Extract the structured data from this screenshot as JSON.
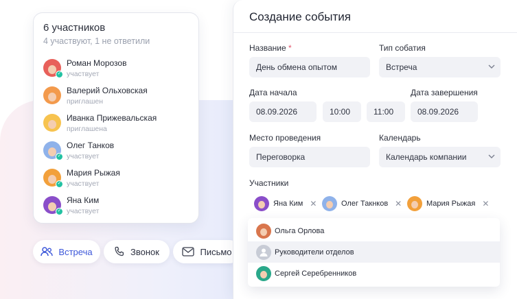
{
  "participants_card": {
    "title": "6 участников",
    "subtitle": "4 участвуют, 1 не ответили",
    "people": [
      {
        "name": "Роман Морозов",
        "status": "участвует",
        "avatar_color": "#e8605a",
        "accepted": true
      },
      {
        "name": "Валерий Ольховская",
        "status": "приглашен",
        "avatar_color": "#f39a4c",
        "accepted": false
      },
      {
        "name": "Иванка Прижевальская",
        "status": "приглашена",
        "avatar_color": "#f7c34f",
        "accepted": false
      },
      {
        "name": "Олег Танков",
        "status": "участвует",
        "avatar_color": "#8fb2ea",
        "accepted": true
      },
      {
        "name": "Мария Рыжая",
        "status": "участвует",
        "avatar_color": "#f2a03b",
        "accepted": true
      },
      {
        "name": "Яна Ким",
        "status": "участвует",
        "avatar_color": "#8a4ec9",
        "accepted": true
      }
    ]
  },
  "channels": [
    {
      "label": "Встреча",
      "icon": "people-icon",
      "active": true
    },
    {
      "label": "Звонок",
      "icon": "phone-icon",
      "active": false
    },
    {
      "label": "Письмо",
      "icon": "mail-icon",
      "active": false
    }
  ],
  "form": {
    "title": "Создание события",
    "name_label": "Название",
    "name_required_mark": "*",
    "name_value": "День обмена опытом",
    "type_label": "Тип собатия",
    "type_value": "Встреча",
    "start_label": "Дата начала",
    "start_date": "08.09.2026",
    "start_time": "10:00",
    "end_time": "11:00",
    "end_label": "Дата завершения",
    "end_date": "08.09.2026",
    "place_label": "Место проведения",
    "place_value": "Переговорка",
    "calendar_label": "Календарь",
    "calendar_value": "Календарь компании",
    "participants_label": "Участники",
    "chips": [
      {
        "name": "Яна Ким",
        "avatar_color": "#8a4ec9"
      },
      {
        "name": "Олег Такнков",
        "avatar_color": "#8fb2ea"
      },
      {
        "name": "Мария Рыжая",
        "avatar_color": "#f2a03b"
      }
    ],
    "remove_glyph": "✕",
    "suggestions": [
      {
        "name": "Ольга Орлова",
        "avatar_color": "#d9764d",
        "group": false
      },
      {
        "name": "Руководители отделов",
        "avatar_color": "#c8ccd6",
        "group": true
      },
      {
        "name": "Сергей Серебренников",
        "avatar_color": "#2aa88a",
        "group": false
      }
    ]
  },
  "colors": {
    "accent": "#3b56d9",
    "accepted_badge": "#22c1a2",
    "required": "#e2546b"
  }
}
